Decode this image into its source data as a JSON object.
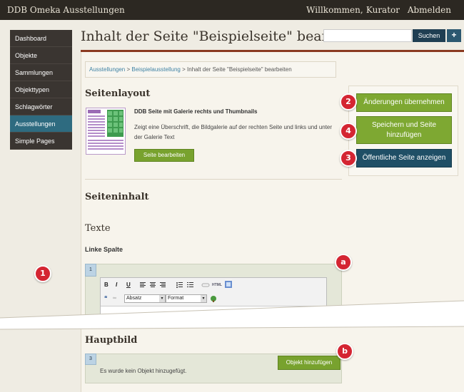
{
  "topbar": {
    "brand": "DDB Omeka Ausstellungen",
    "welcome_label": "Willkommen,",
    "welcome_user": "Kurator",
    "logout": "Abmelden"
  },
  "sidebar": {
    "items": [
      {
        "label": "Dashboard"
      },
      {
        "label": "Objekte"
      },
      {
        "label": "Sammlungen"
      },
      {
        "label": "Objekttypen"
      },
      {
        "label": "Schlagwörter"
      },
      {
        "label": "Ausstellungen",
        "active": true
      },
      {
        "label": "Simple Pages"
      }
    ]
  },
  "header": {
    "title": "Inhalt der Seite \"Beispielseite\" bearbei...",
    "search_button": "Suchen",
    "add_button": "+"
  },
  "breadcrumb": {
    "crumb1": "Ausstellungen",
    "sep1": " > ",
    "crumb2": "Beispielausstellung",
    "sep2": " > ",
    "current": "Inhalt der Seite \"Beispielseite\" bearbeiten"
  },
  "layout_section": {
    "heading": "Seitenlayout",
    "layout_name": "DDB Seite mit Galerie rechts und Thumbnails",
    "layout_desc": "Zeigt eine Überschrift, die Bildgalerie auf der rechten Seite und links und unter der Galerie Text",
    "edit_button": "Seite bearbeiten"
  },
  "actions": {
    "apply": "Änderungen übernehmen",
    "save": "Speichern und Seite hinzufügen",
    "view": "Öffentliche Seite anzeigen"
  },
  "content_section": {
    "heading": "Seiteninhalt",
    "subheading": "Texte",
    "left_column": "Linke Spalte",
    "block1_number": "1",
    "format_select": "Absatz",
    "style_select": "Format",
    "main_image_heading": "Hauptbild",
    "block2_number": "3",
    "no_object_text": "Es wurde kein Objekt hinzugefügt.",
    "add_object_button": "Objekt hinzufügen"
  },
  "toolbar": {
    "bold": "B",
    "italic": "I",
    "underline": "U",
    "html": "HTML"
  },
  "markers": {
    "m1": "1",
    "m2": "2",
    "m3": "3",
    "m4": "4",
    "ma": "a",
    "mb": "b"
  },
  "colors": {
    "accent_green": "#7ea832",
    "accent_dark_blue": "#1f4f66",
    "nav_active": "#2e6b80",
    "accent_red_line": "#8b3a20",
    "marker_red": "#d42532"
  }
}
